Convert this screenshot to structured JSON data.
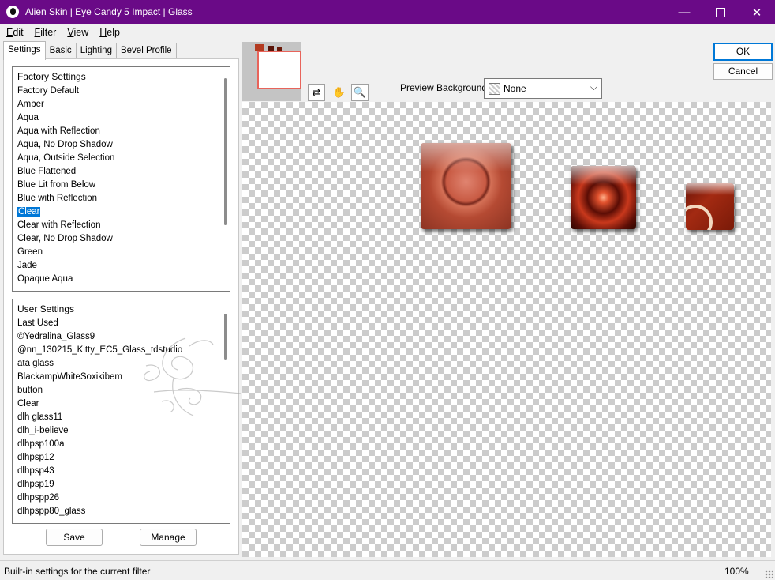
{
  "window": {
    "title": "Alien Skin | Eye Candy 5 Impact | Glass",
    "minimize": "—",
    "close": "✕"
  },
  "menu": {
    "items": [
      {
        "mnemonic": "E",
        "rest": "dit"
      },
      {
        "mnemonic": "F",
        "rest": "ilter"
      },
      {
        "mnemonic": "V",
        "rest": "iew"
      },
      {
        "mnemonic": "H",
        "rest": "elp"
      }
    ]
  },
  "tabs": [
    "Settings",
    "Basic",
    "Lighting",
    "Bevel Profile"
  ],
  "factory_settings": {
    "header": "Factory Settings",
    "items": [
      "Factory Default",
      "Amber",
      "Aqua",
      "Aqua with Reflection",
      "Aqua, No Drop Shadow",
      "Aqua, Outside Selection",
      "Blue Flattened",
      "Blue Lit from Below",
      "Blue with Reflection",
      "Clear",
      "Clear with Reflection",
      "Clear, No Drop Shadow",
      "Green",
      "Jade",
      "Opaque Aqua"
    ],
    "selected": "Clear"
  },
  "user_settings": {
    "header": "User Settings",
    "items": [
      "Last Used",
      "©Yedralina_Glass9",
      "@nn_130215_Kitty_EC5_Glass_tdstudio",
      "ata glass",
      "BlackampWhiteSoxikibem",
      "button",
      "Clear",
      "dlh glass11",
      "dlh_i-believe",
      "dlhpsp100a",
      "dlhpsp12",
      "dlhpsp43",
      "dlhpsp19",
      "dlhpspp26",
      "dlhpspp80_glass"
    ]
  },
  "buttons": {
    "save": "Save",
    "manage": "Manage",
    "ok": "OK",
    "cancel": "Cancel"
  },
  "preview_background": {
    "label": "Preview Background:",
    "value": "None"
  },
  "tools": {
    "hand": "✋",
    "zoom": "🔍",
    "pan": "⇄"
  },
  "status": {
    "text": "Built-in settings for the current filter",
    "zoom": "100%"
  },
  "colors": {
    "titlebar": "#6a0a87",
    "selection": "#0078d7"
  }
}
